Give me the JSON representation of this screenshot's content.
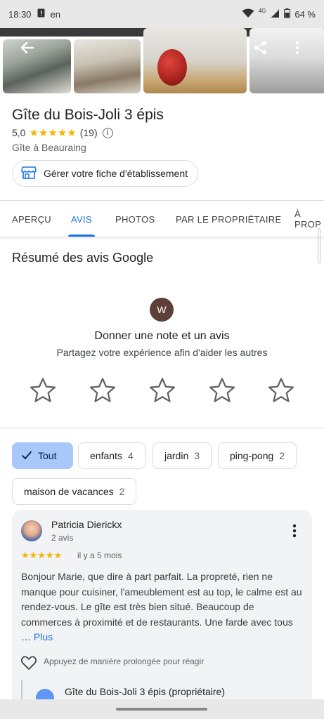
{
  "status_bar": {
    "time": "18:30",
    "left_label": "en",
    "network": "4G",
    "battery": "64 %"
  },
  "place": {
    "title": "Gîte du Bois-Joli 3 épis",
    "rating": "5,0",
    "stars": "★★★★★",
    "review_count": "(19)",
    "category": "Gîte à Beauraing",
    "manage_label": "Gérer votre fiche d'établissement"
  },
  "tabs": [
    {
      "label": "APERÇU",
      "active": false
    },
    {
      "label": "AVIS",
      "active": true
    },
    {
      "label": "PHOTOS",
      "active": false
    },
    {
      "label": "PAR LE PROPRIÉTAIRE",
      "active": false
    },
    {
      "label": "À PROP",
      "active": false
    }
  ],
  "summary": {
    "title": "Résumé des avis Google",
    "avatar_letter": "W",
    "rate_title": "Donner une note et un avis",
    "rate_subtitle": "Partagez votre expérience afin d'aider les autres"
  },
  "chips": [
    {
      "label": "Tout",
      "count": "",
      "selected": true
    },
    {
      "label": "enfants",
      "count": "4",
      "selected": false
    },
    {
      "label": "jardin",
      "count": "3",
      "selected": false
    },
    {
      "label": "ping-pong",
      "count": "2",
      "selected": false
    },
    {
      "label": "maison de vacances",
      "count": "2",
      "selected": false
    }
  ],
  "review": {
    "author": "Patricia Dierickx",
    "author_reviews": "2 avis",
    "stars": "★★★★★",
    "time": "il y a 5 mois",
    "text": "Bonjour Marie, que dire à part parfait. La propreté, rien ne manque pour cuisiner, l'ameublement est au top, le calme est au rendez-vous. Le gîte est très bien situé. Beaucoup de commerces à proximité et de restaurants. Une farde avec tous …",
    "more_label": "Plus",
    "react_hint": "Appuyez de manière prolongée pour réagir",
    "owner_reply_name": "Gîte du Bois-Joli 3 épis (propriétaire)"
  },
  "colors": {
    "accent": "#1a73e8",
    "star": "#f4b400",
    "chip_selected": "#a8c7fa",
    "avatar_w": "#5d4037"
  }
}
